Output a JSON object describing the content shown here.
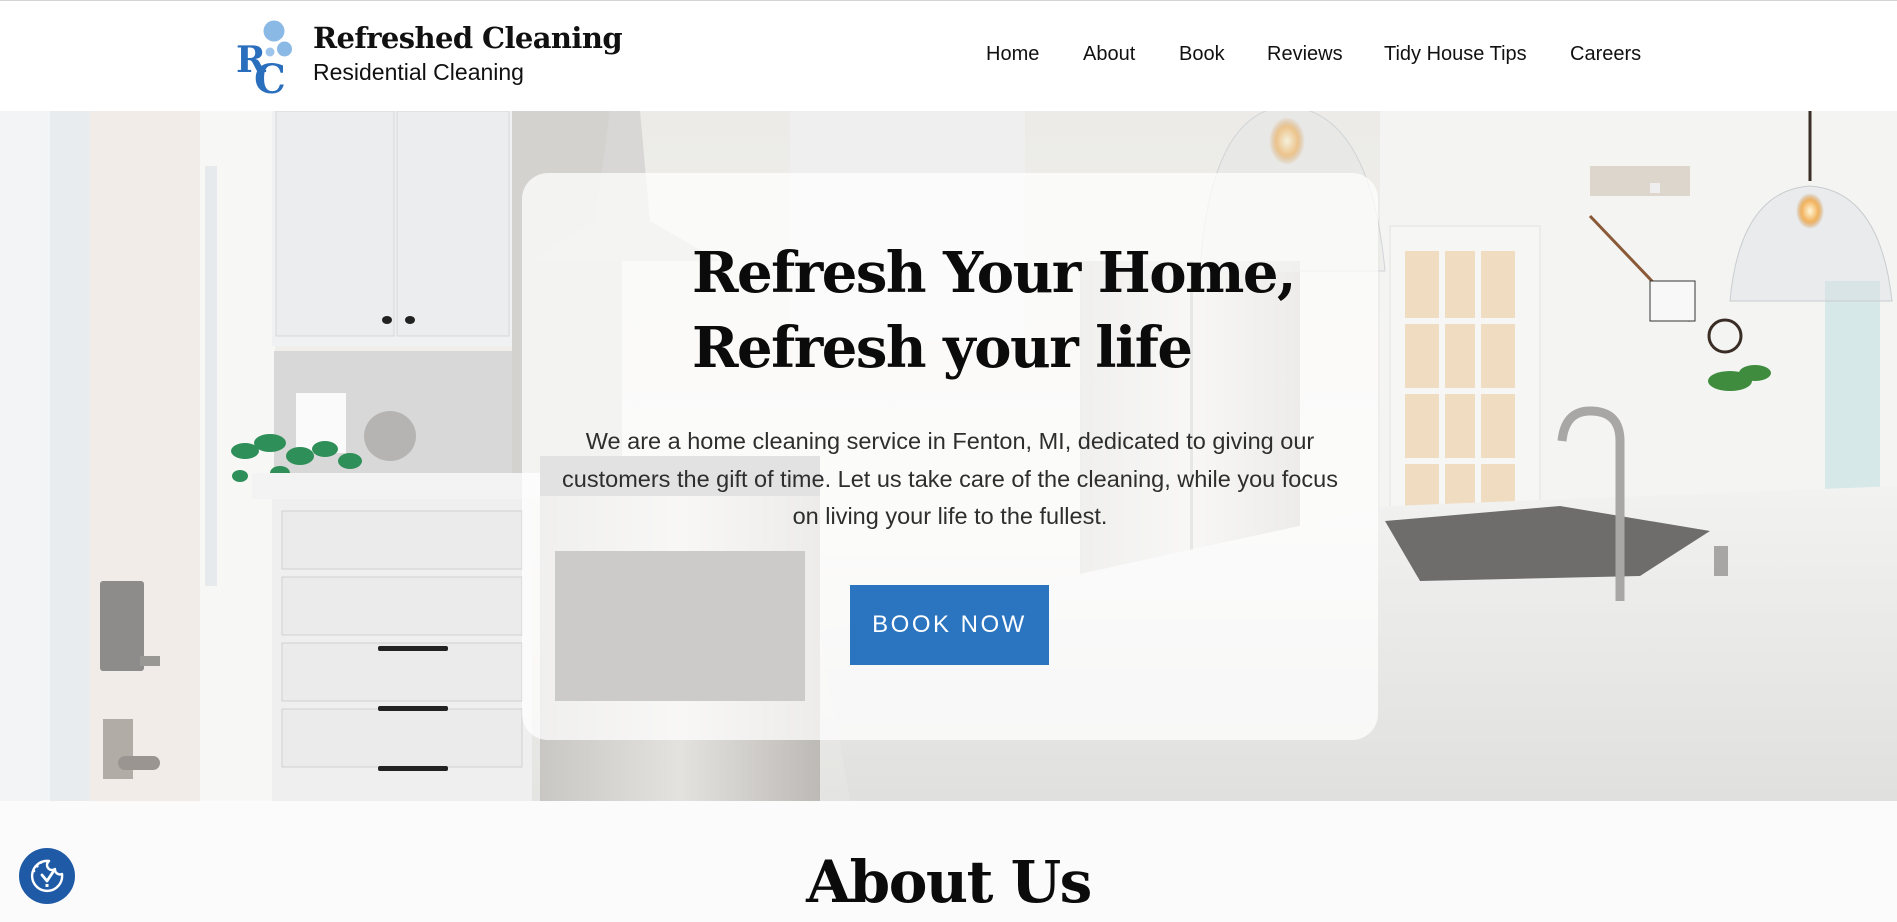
{
  "brand": {
    "name": "Refreshed Cleaning",
    "tagline": "Residential Cleaning",
    "logo_letters": [
      "R",
      "C"
    ],
    "logo_icon": "bubbles-monogram-icon",
    "colors": {
      "logo_blue": "#2a6fbd",
      "bubble_blue": "#8bb9e6"
    }
  },
  "nav": {
    "items": [
      {
        "label": "Home"
      },
      {
        "label": "About"
      },
      {
        "label": "Book"
      },
      {
        "label": "Reviews"
      },
      {
        "label": "Tidy House Tips"
      },
      {
        "label": "Careers"
      }
    ]
  },
  "hero": {
    "background": "kitchen-photo",
    "title_lines": [
      "Refresh Your Home,",
      "Refresh your life"
    ],
    "description": "We are a home cleaning service in Fenton, MI, dedicated to giving our customers the gift of time. Let us take care of the cleaning, while you focus on living your life to the fullest.",
    "cta_label": "BOOK NOW",
    "colors": {
      "cta": "#2a74c0",
      "cta_text": "#ffffff"
    }
  },
  "about": {
    "title": "About Us"
  },
  "cookie_consent": {
    "icon": "cookie-check-icon",
    "color": "#1f5aa6"
  }
}
